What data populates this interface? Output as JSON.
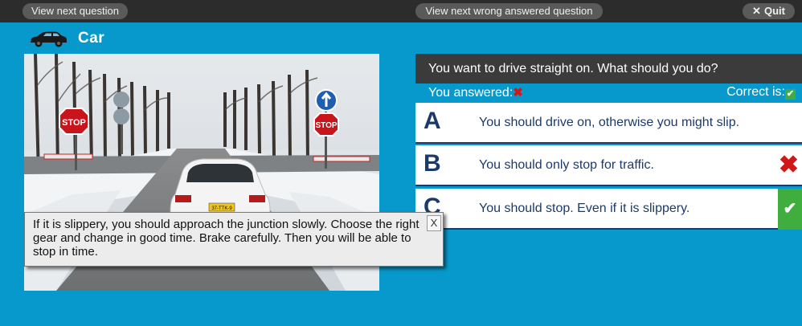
{
  "topbar": {
    "next_label": "View next question",
    "wrong_label": "View next wrong answered question",
    "quit_icon": "✕",
    "quit_label": "Quit"
  },
  "category": {
    "title": "Car",
    "icon": "car-icon"
  },
  "question": {
    "text": "You want to drive straight on. What should you do?",
    "answered_label": "You answered:",
    "answered_mark": "✖",
    "correct_label": "Correct is:",
    "correct_mark": "✔"
  },
  "options": [
    {
      "letter": "A",
      "text": "You should drive on, otherwise you might slip."
    },
    {
      "letter": "B",
      "text": "You should only stop for traffic.",
      "mark": "✖"
    },
    {
      "letter": "C",
      "text": "You should stop. Even if it is slippery.",
      "mark": "✔"
    }
  ],
  "scene": {
    "left_sign": "STOP",
    "right_sign": "STOP",
    "plate": "37-TTK-9"
  },
  "explanation": {
    "text": "If it is slippery, you should approach the junction slowly. Choose the right gear and change in good time. Brake carefully. Then you will be able to stop in time.",
    "close": "X"
  },
  "colors": {
    "background": "#0899cc",
    "topbar": "#2c2c2c",
    "question_bar": "#3b3b3b",
    "wrong": "#d01818",
    "correct": "#3fae3f",
    "letter": "#1b3a6b"
  }
}
